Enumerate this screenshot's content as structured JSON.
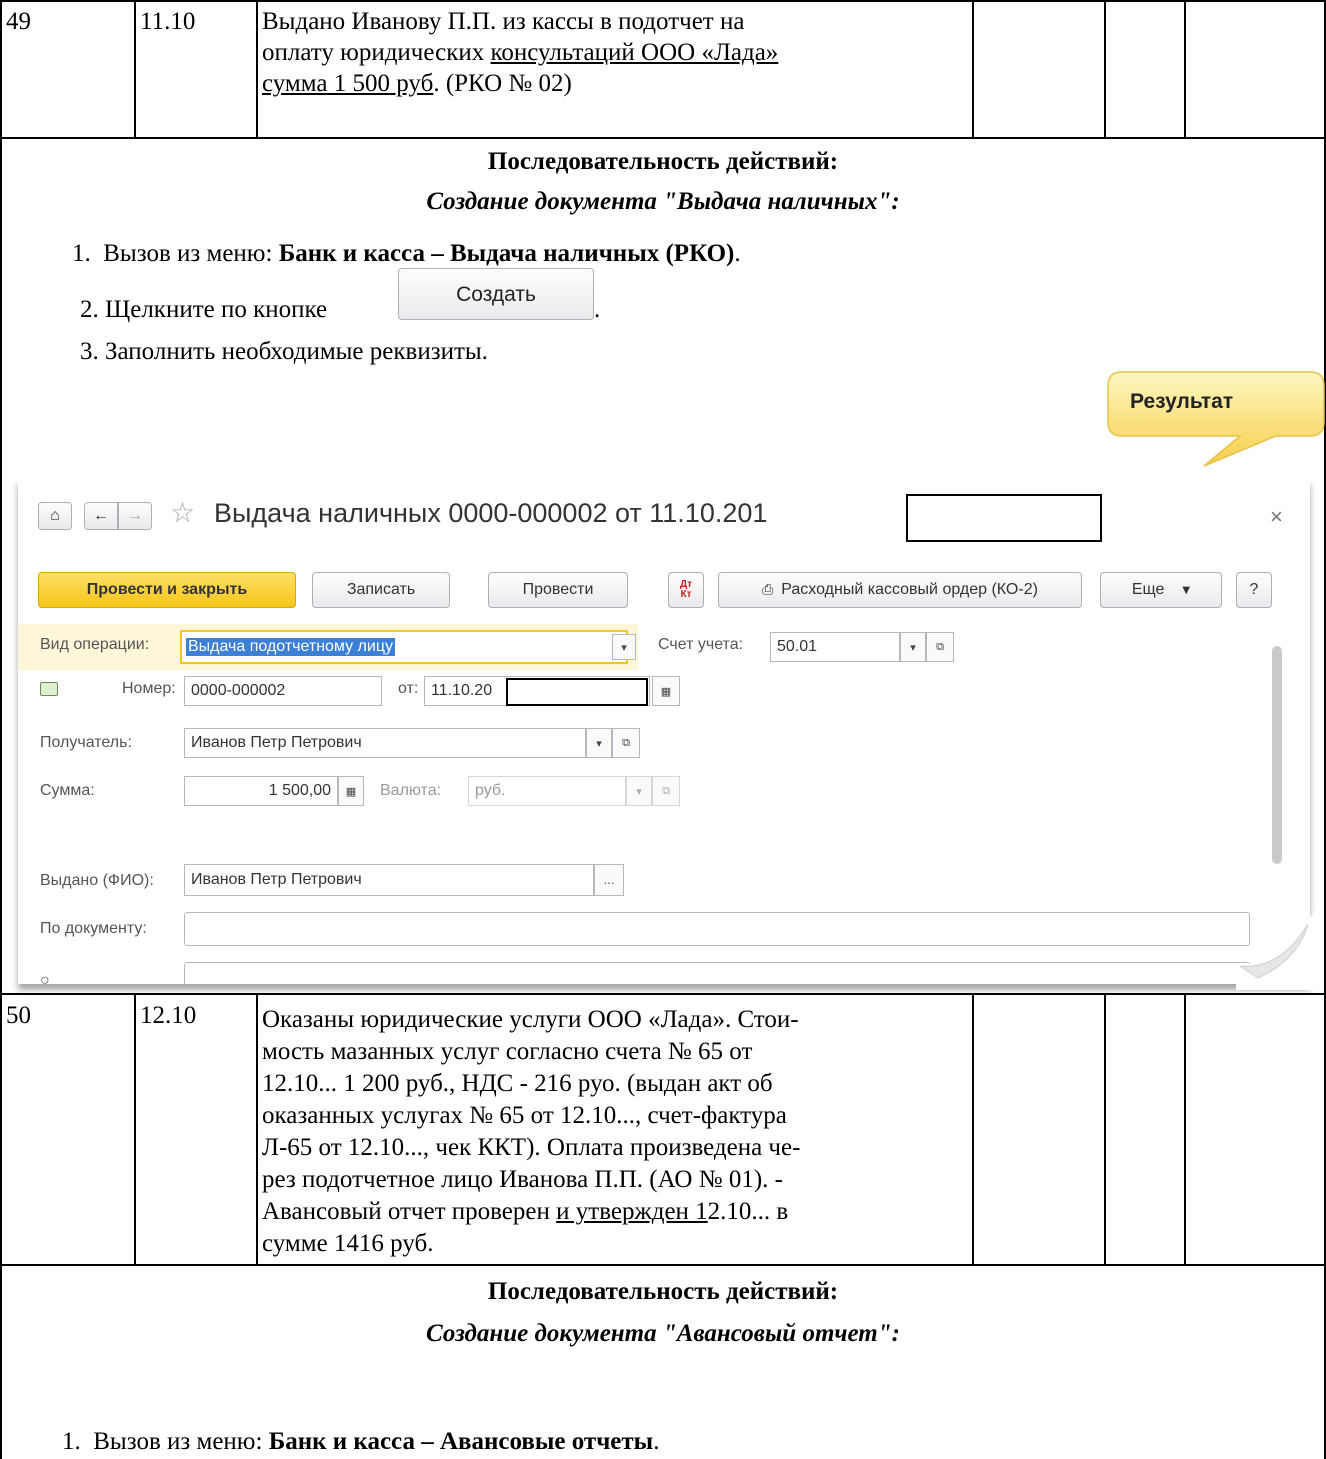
{
  "row49": {
    "num": "49",
    "date": "11.10",
    "text_l1": "Выдано Иванову П.П. из кассы в подотчет на",
    "text_l2a": "оплату юридических ",
    "text_l2b": "консультаций ООО «Лада»",
    "text_l3a": "сумма 1 500 руб",
    "text_l3b": ". (РКО № 02)"
  },
  "section1": {
    "heading": "Последовательность действий:",
    "subheading": "Создание документа \"Выдача наличных\":",
    "step1_num": "1.",
    "step1_text": "Вызов из меню: ",
    "step1_bold": "Банк и касса – Выдача наличных (РКО)",
    "step1_end": ".",
    "step2_num": "2.",
    "step2_text": "Щелкните по кнопке",
    "step2_button": "Создать",
    "step2_end": ".",
    "step3_num": "3.",
    "step3_text": "Заполнить необходимые реквизиты.",
    "callout": "Результат"
  },
  "form": {
    "title": "Выдача наличных 0000-000002 от 11.10.201",
    "close": "×",
    "btn_post_close": "Провести и закрыть",
    "btn_save": "Записать",
    "btn_post": "Провести",
    "btn_dtkt_top": "Дт",
    "btn_dtkt_bottom": "Кт",
    "btn_print": "Расходный кассовый ордер (КО-2)",
    "btn_more": "Еще",
    "btn_help": "?",
    "lbl_operation": "Вид операции:",
    "val_operation": "Выдача подотчетному лицу",
    "lbl_account": "Счет учета:",
    "val_account": "50.01",
    "lbl_number": "Номер:",
    "val_number": "0000-000002",
    "lbl_from": "от:",
    "val_date": "11.10.20",
    "lbl_recipient": "Получатель:",
    "val_recipient": "Иванов Петр Петрович",
    "lbl_sum": "Сумма:",
    "val_sum": "1 500,00",
    "lbl_currency": "Валюта:",
    "val_currency": "руб.",
    "lbl_issued": "Выдано (ФИО):",
    "val_issued": "Иванов Петр Петрович",
    "lbl_document": "По документу:",
    "val_document": ""
  },
  "row50": {
    "num": "50",
    "date": "12.10",
    "l1": "Оказаны юридические услуги ООО «Лада». Стои-",
    "l2": "мость мазанных услуг согласно счета № 65 от",
    "l3": "12.10... 1 200 руб., НДС - 216 руо. (выдан акт об",
    "l4": "оказанных услугах № 65 от 12.10..., счет-фактура",
    "l5": "Л-65 от 12.10..., чек ККТ). Оплата произведена че-",
    "l6": "рез подотчетное лицо Иванова П.П. (АО № 01). -",
    "l7a": "Авансовый отчет проверен ",
    "l7b": "и утвержден 1",
    "l7c": "2.10... в",
    "l8": "сумме 1416 руб."
  },
  "section2": {
    "heading": "Последовательность действий:",
    "subheading": "Создание документа \"Авансовый отчет\":",
    "step1_num": "1.",
    "step1_text": "Вызов из меню: ",
    "step1_bold": "Банк и касса – Авансовые отчеты",
    "step1_end": "."
  }
}
